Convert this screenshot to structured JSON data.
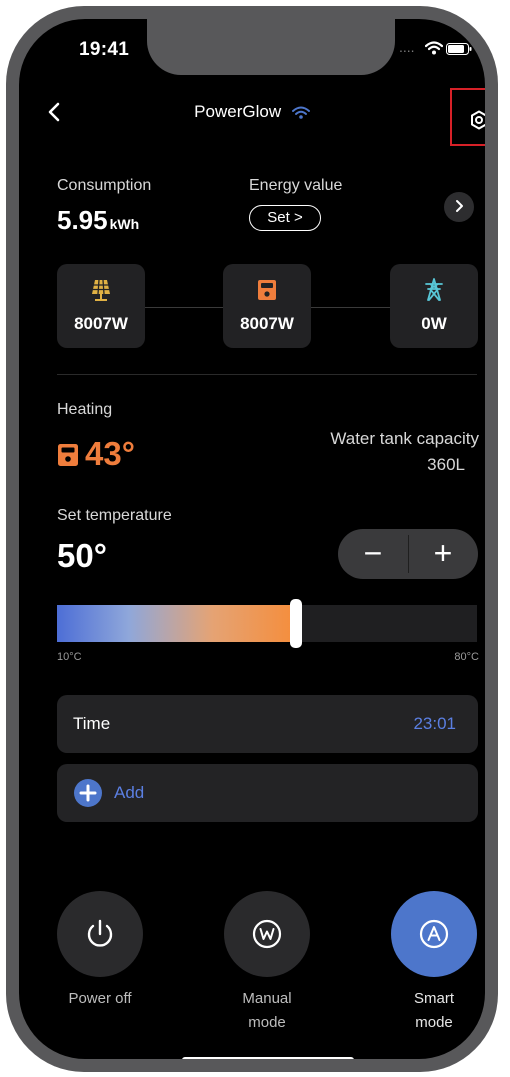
{
  "status_bar": {
    "time": "19:41",
    "signal": "...."
  },
  "header": {
    "title": "PowerGlow"
  },
  "consumption": {
    "label": "Consumption",
    "value": "5.95",
    "unit": "kWh"
  },
  "energy_value": {
    "label": "Energy value",
    "button_label": "Set >"
  },
  "energy_flow": {
    "solar_power": "8007W",
    "battery_power": "8007W",
    "grid_power": "0W"
  },
  "heating": {
    "label": "Heating",
    "temperature": "43°"
  },
  "tank": {
    "label": "Water tank capacity",
    "value": "360L"
  },
  "set_temperature": {
    "label": "Set temperature",
    "value": "50°",
    "minus_label": "−",
    "plus_label": "+",
    "slider_min_label": "10°C",
    "slider_max_label": "80°C",
    "slider_level": 0.57
  },
  "schedule": {
    "time_label": "Time",
    "time_value": "23:01",
    "add_label": "Add"
  },
  "modes": [
    {
      "label_line1": "Power off",
      "label_line2": ""
    },
    {
      "label_line1": "Manual",
      "label_line2": "mode"
    },
    {
      "label_line1": "Smart",
      "label_line2": "mode"
    }
  ],
  "colors": {
    "accent_blue": "#4d76cb",
    "heating_orange": "#ef7d3c",
    "time_blue": "#5b7fe2",
    "highlight_red": "#d72128"
  },
  "icons": [
    "wifi-icon",
    "battery-icon",
    "back-icon",
    "settings-icon",
    "solar-panel-icon",
    "battery-storage-icon",
    "power-tower-icon",
    "water-heater-icon",
    "plus-circle-icon",
    "power-icon",
    "manual-mode-icon",
    "smart-mode-icon"
  ]
}
